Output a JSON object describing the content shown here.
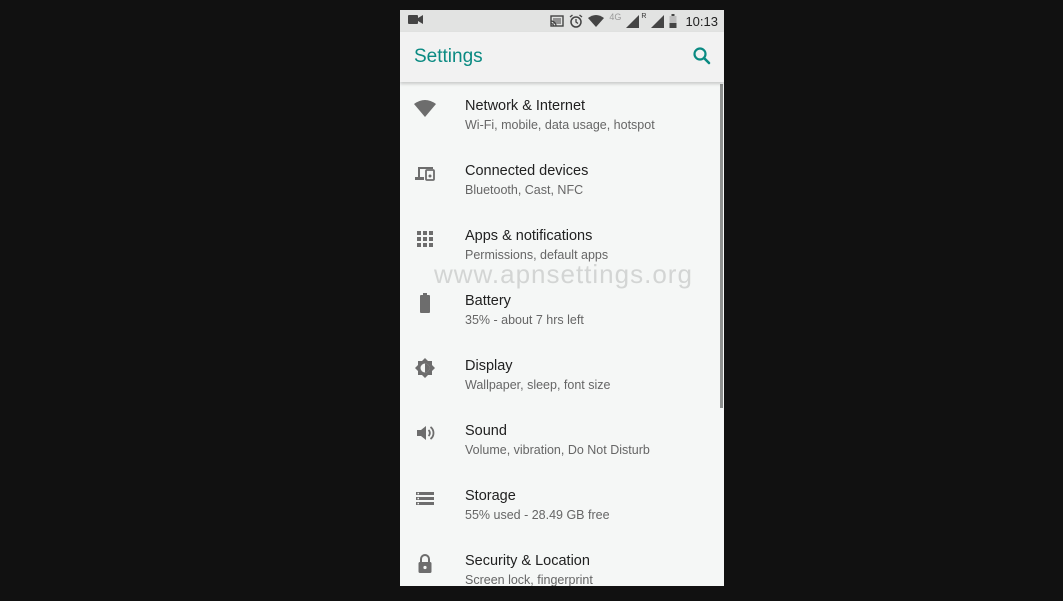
{
  "status_bar": {
    "time": "10:13",
    "network_type": "4G",
    "roaming": "R",
    "left_icon": "video-camera-icon",
    "right_icons": [
      "cast-icon",
      "alarm-icon",
      "wifi-icon",
      "signal-icon",
      "signal-icon",
      "battery-icon"
    ]
  },
  "app_bar": {
    "title": "Settings",
    "search_icon": "search-icon",
    "accent_color": "#0a8a82"
  },
  "settings_items": [
    {
      "title": "Network & Internet",
      "summary": "Wi-Fi, mobile, data usage, hotspot",
      "icon": "wifi-icon"
    },
    {
      "title": "Connected devices",
      "summary": "Bluetooth, Cast, NFC",
      "icon": "devices-icon"
    },
    {
      "title": "Apps & notifications",
      "summary": "Permissions, default apps",
      "icon": "apps-grid-icon"
    },
    {
      "title": "Battery",
      "summary": "35% - about 7 hrs left",
      "icon": "battery-icon"
    },
    {
      "title": "Display",
      "summary": "Wallpaper, sleep, font size",
      "icon": "brightness-icon"
    },
    {
      "title": "Sound",
      "summary": "Volume, vibration, Do Not Disturb",
      "icon": "volume-icon"
    },
    {
      "title": "Storage",
      "summary": "55% used - 28.49 GB free",
      "icon": "storage-icon"
    },
    {
      "title": "Security & Location",
      "summary": "Screen lock, fingerprint",
      "icon": "lock-icon"
    }
  ],
  "watermark": "www.apnsettings.org"
}
